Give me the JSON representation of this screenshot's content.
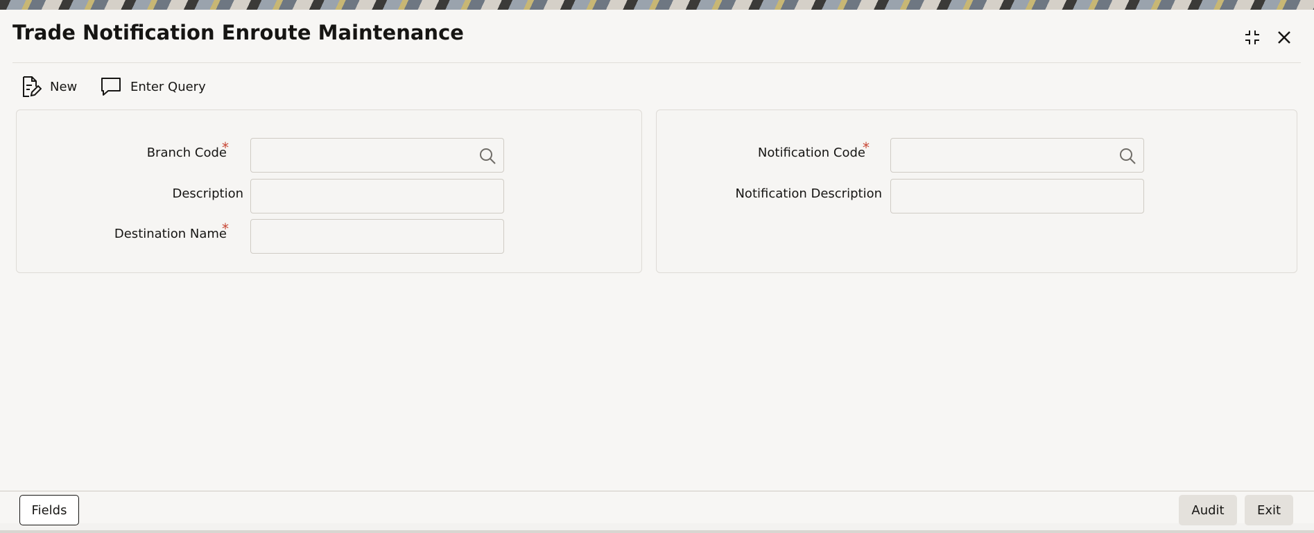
{
  "window": {
    "title": "Trade Notification Enroute Maintenance",
    "controls": {
      "maximize_icon": "fullscreen-corners-icon",
      "close_icon": "close-icon"
    }
  },
  "toolbar": {
    "new_label": "New",
    "new_icon": "document-edit-icon",
    "enter_query_label": "Enter Query",
    "enter_query_icon": "chat-bubble-icon"
  },
  "left_panel": {
    "branch_code": {
      "label": "Branch Code",
      "required": "*",
      "value": ""
    },
    "description": {
      "label": "Description",
      "value": ""
    },
    "destination_name": {
      "label": "Destination Name",
      "required": "*",
      "value": ""
    }
  },
  "right_panel": {
    "notification_code": {
      "label": "Notification Code",
      "required": "*",
      "value": ""
    },
    "notification_description": {
      "label": "Notification Description",
      "value": ""
    }
  },
  "footer": {
    "fields_label": "Fields",
    "audit_label": "Audit",
    "exit_label": "Exit"
  },
  "colors": {
    "required_marker": "#c74634",
    "background": "#f7f6f4",
    "text": "#161513"
  }
}
